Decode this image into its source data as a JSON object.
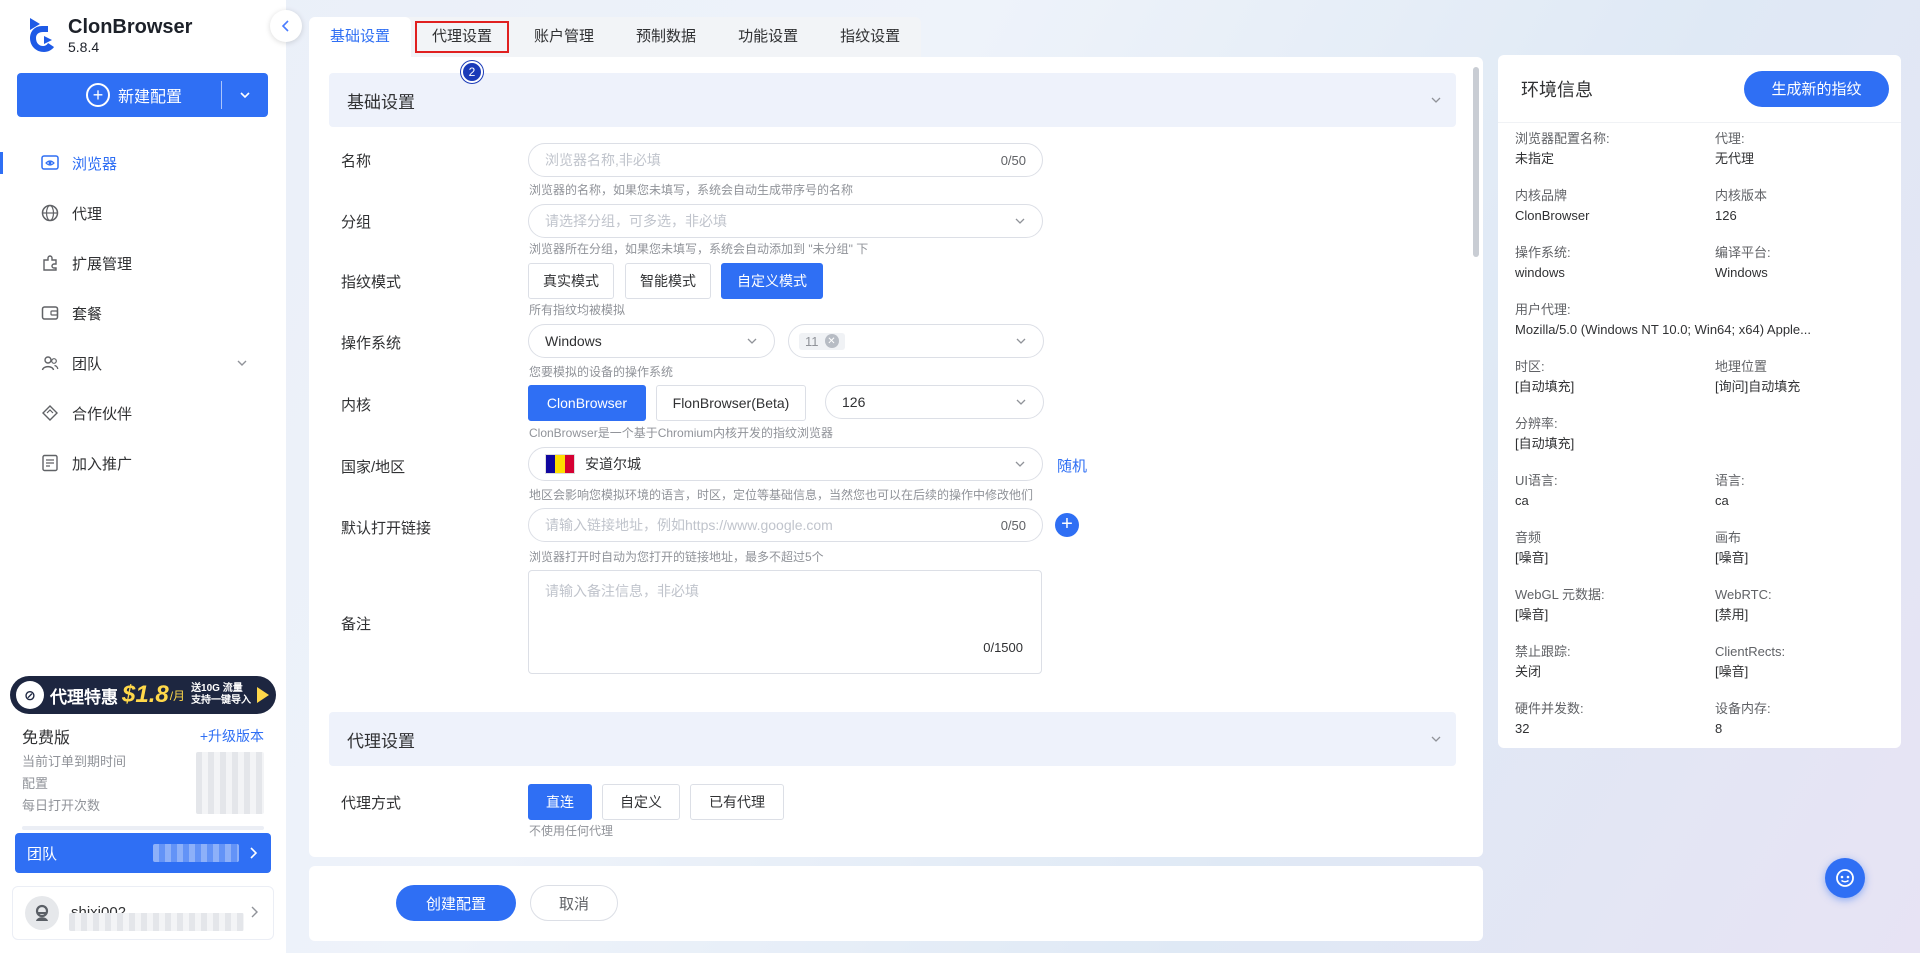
{
  "app": {
    "name": "ClonBrowser",
    "version": "5.8.4"
  },
  "sidebar": {
    "new_config_label": "新建配置",
    "items": [
      {
        "label": "浏览器",
        "icon": "browser-icon"
      },
      {
        "label": "代理",
        "icon": "globe-icon"
      },
      {
        "label": "扩展管理",
        "icon": "puzzle-icon"
      },
      {
        "label": "套餐",
        "icon": "wallet-icon"
      },
      {
        "label": "团队",
        "icon": "team-icon"
      },
      {
        "label": "合作伙伴",
        "icon": "partner-icon"
      },
      {
        "label": "加入推广",
        "icon": "promo-icon"
      }
    ],
    "promo": {
      "title": "代理特惠",
      "price": "$1.8",
      "unit": "/月",
      "sub1": "送10G 流量",
      "sub2": "支持一键导入"
    },
    "plan": {
      "name": "免费版",
      "upgrade": "+升级版本",
      "expire_label": "当前订单到期时间",
      "config_label": "配置",
      "daily_open_label": "每日打开次数"
    },
    "team_label": "团队",
    "user": {
      "name": "shixi002"
    }
  },
  "tabs": [
    "基础设置",
    "代理设置",
    "账户管理",
    "预制数据",
    "功能设置",
    "指纹设置"
  ],
  "step_badge": "2",
  "basic": {
    "section_title": "基础设置",
    "name": {
      "label": "名称",
      "placeholder": "浏览器名称,非必填",
      "counter": "0/50",
      "hint": "浏览器的名称，如果您未填写，系统会自动生成带序号的名称"
    },
    "group": {
      "label": "分组",
      "placeholder": "请选择分组，可多选，非必填",
      "hint": "浏览器所在分组，如果您未填写，系统会自动添加到 \"未分组\" 下"
    },
    "fingerprint": {
      "label": "指纹模式",
      "options": [
        "真实模式",
        "智能模式",
        "自定义模式"
      ],
      "hint": "所有指纹均被模拟"
    },
    "os": {
      "label": "操作系统",
      "value": "Windows",
      "version": "11",
      "hint": "您要模拟的设备的操作系统"
    },
    "kernel": {
      "label": "内核",
      "options": [
        "ClonBrowser",
        "FlonBrowser(Beta)"
      ],
      "version": "126",
      "hint": "ClonBrowser是一个基于Chromium内核开发的指纹浏览器"
    },
    "country": {
      "label": "国家/地区",
      "value": "安道尔城",
      "random": "随机",
      "hint": "地区会影响您模拟环境的语言，时区，定位等基础信息，当然您也可以在后续的操作中修改他们"
    },
    "url": {
      "label": "默认打开链接",
      "placeholder": "请输入链接地址，例如https://www.google.com",
      "counter": "0/50",
      "hint": "浏览器打开时自动为您打开的链接地址，最多不超过5个"
    },
    "note": {
      "label": "备注",
      "placeholder": "请输入备注信息，非必填",
      "counter": "0/1500"
    }
  },
  "proxy": {
    "section_title": "代理设置",
    "mode": {
      "label": "代理方式",
      "options": [
        "直连",
        "自定义",
        "已有代理"
      ],
      "hint": "不使用任何代理"
    }
  },
  "footer": {
    "create": "创建配置",
    "cancel": "取消"
  },
  "env": {
    "title": "环境信息",
    "regen": "生成新的指纹",
    "items": [
      {
        "k": "浏览器配置名称:",
        "v": "未指定"
      },
      {
        "k": "代理:",
        "v": "无代理"
      },
      {
        "k": "内核品牌",
        "v": "ClonBrowser"
      },
      {
        "k": "内核版本",
        "v": "126"
      },
      {
        "k": "操作系统:",
        "v": "windows"
      },
      {
        "k": "编译平台:",
        "v": "Windows"
      },
      {
        "k": "用户代理:",
        "v": "Mozilla/5.0 (Windows NT 10.0; Win64; x64) Apple..."
      },
      {
        "k": "时区:",
        "v": "[自动填充]"
      },
      {
        "k": "地理位置",
        "v": "[询问]自动填充"
      },
      {
        "k": "分辨率:",
        "v": "[自动填充]"
      },
      {
        "k": "UI语言:",
        "v": "ca"
      },
      {
        "k": "语言:",
        "v": "ca"
      },
      {
        "k": "音频",
        "v": "[噪音]"
      },
      {
        "k": "画布",
        "v": "[噪音]"
      },
      {
        "k": "WebGL 元数据:",
        "v": "[噪音]"
      },
      {
        "k": "WebRTC:",
        "v": "[禁用]"
      },
      {
        "k": "禁止跟踪:",
        "v": "关闭"
      },
      {
        "k": "ClientRects:",
        "v": "[噪音]"
      },
      {
        "k": "硬件并发数:",
        "v": "32"
      },
      {
        "k": "设备内存:",
        "v": "8"
      }
    ]
  },
  "colors": {
    "primary": "#2f6ff4",
    "section_bg": "#eef2fb",
    "highlight": "#e02020"
  }
}
